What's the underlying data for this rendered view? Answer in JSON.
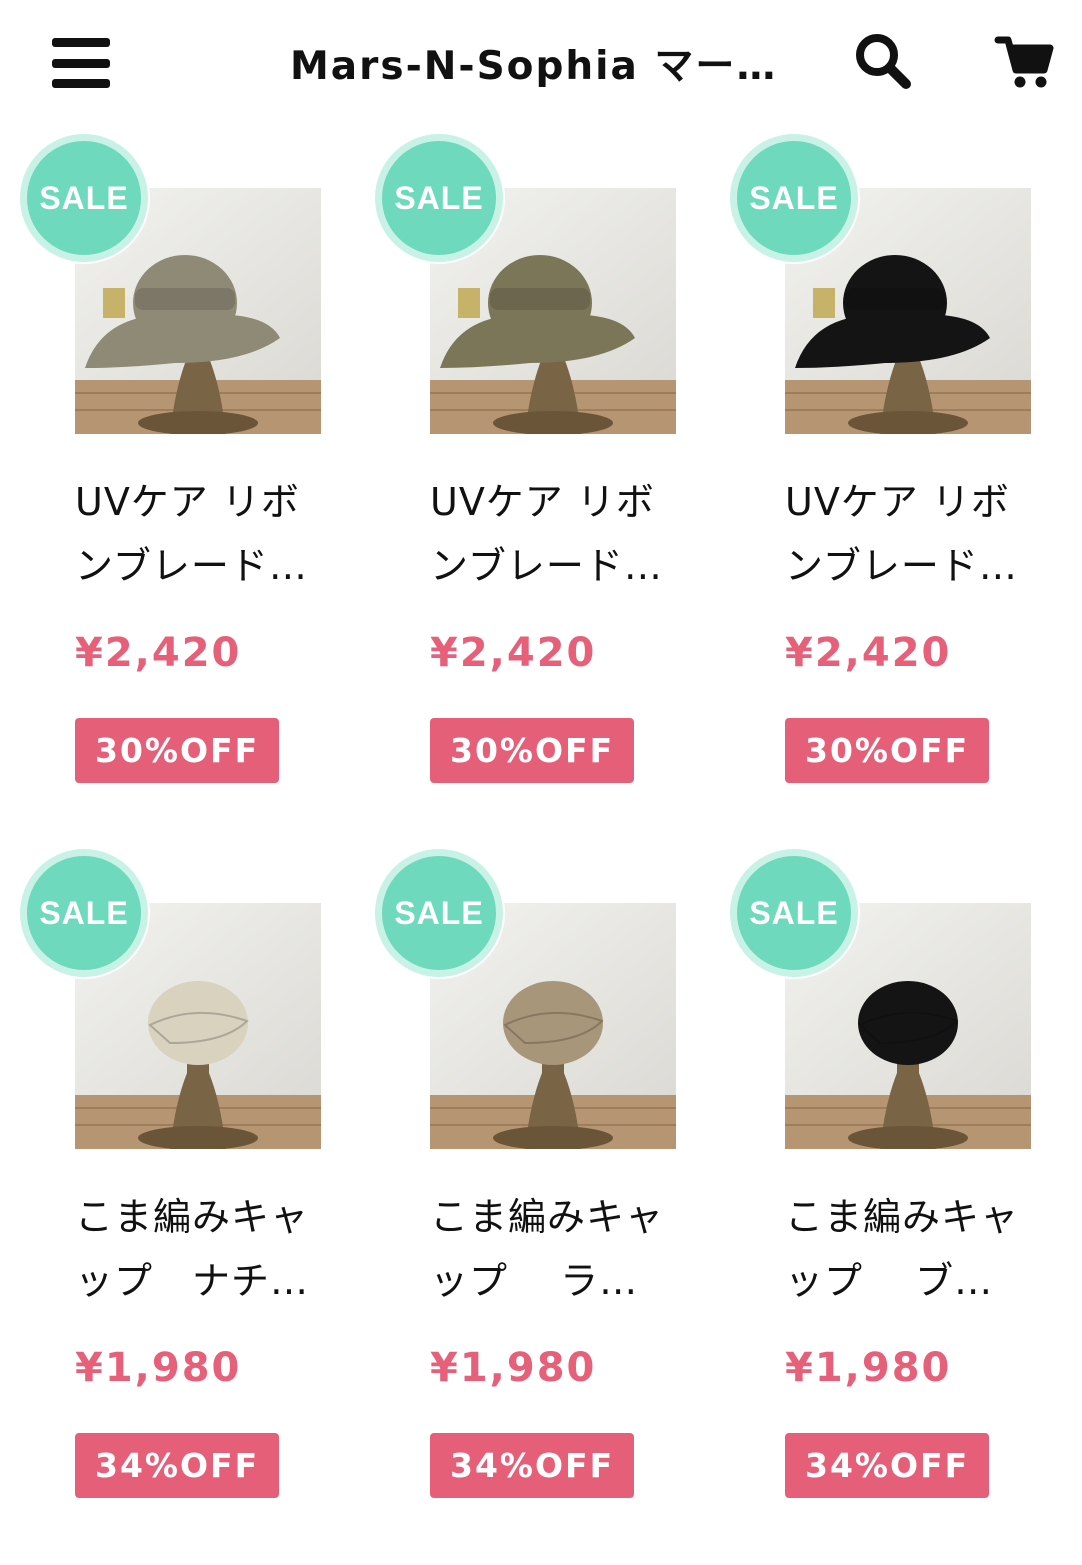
{
  "header": {
    "title": "Mars-N-Sophia マー…",
    "menu_icon": "hamburger-menu-icon",
    "search_icon": "search-icon",
    "cart_icon": "cart-icon"
  },
  "colors": {
    "sale_badge": "#6ed9bd",
    "price": "#e6607a",
    "discount_badge": "#e55f78"
  },
  "products": [
    {
      "sale_label": "SALE",
      "name": "UVケア リボンブレード…",
      "price": "¥2,420",
      "discount": "30%OFF",
      "hat_color": "#8f8a76",
      "hat_style": "wide-brim"
    },
    {
      "sale_label": "SALE",
      "name": "UVケア リボンブレード…",
      "price": "¥2,420",
      "discount": "30%OFF",
      "hat_color": "#7c7659",
      "hat_style": "wide-brim"
    },
    {
      "sale_label": "SALE",
      "name": "UVケア リボンブレード…",
      "price": "¥2,420",
      "discount": "30%OFF",
      "hat_color": "#141414",
      "hat_style": "wide-brim"
    },
    {
      "sale_label": "SALE",
      "name": "こま編みキャップ　ナチ…",
      "price": "¥1,980",
      "discount": "34%OFF",
      "hat_color": "#d8d2bf",
      "hat_style": "cap"
    },
    {
      "sale_label": "SALE",
      "name": "こま編みキャップ　 ラ…",
      "price": "¥1,980",
      "discount": "34%OFF",
      "hat_color": "#a8967a",
      "hat_style": "cap"
    },
    {
      "sale_label": "SALE",
      "name": "こま編みキャップ　 ブ…",
      "price": "¥1,980",
      "discount": "34%OFF",
      "hat_color": "#141414",
      "hat_style": "cap"
    }
  ]
}
